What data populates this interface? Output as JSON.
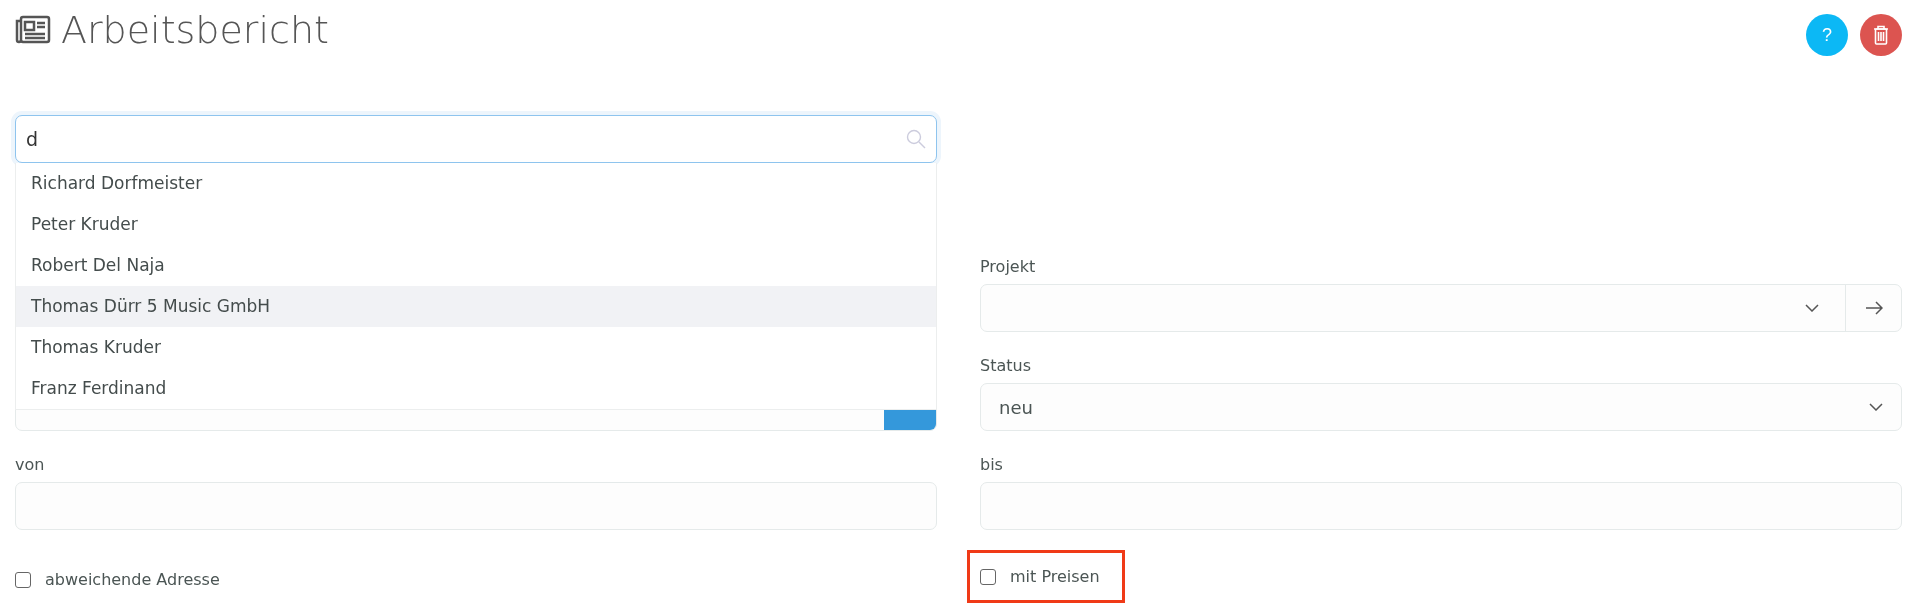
{
  "header": {
    "title": "Arbeitsbericht",
    "actions": [
      {
        "kind": "help",
        "label": "?"
      },
      {
        "kind": "delete"
      }
    ]
  },
  "search": {
    "value": "d",
    "suggestions": [
      {
        "label": "Richard Dorfmeister",
        "selected": false
      },
      {
        "label": "Peter Kruder",
        "selected": false
      },
      {
        "label": "Robert Del Naja",
        "selected": false
      },
      {
        "label": "Thomas Dürr 5 Music GmbH",
        "selected": true
      },
      {
        "label": "Thomas Kruder",
        "selected": false
      },
      {
        "label": "Franz Ferdinand",
        "selected": false
      }
    ]
  },
  "projekt": {
    "label": "Projekt"
  },
  "status": {
    "label": "Status",
    "value": "neu"
  },
  "von": {
    "label": "von"
  },
  "bis": {
    "label": "bis"
  },
  "checkboxes": [
    {
      "label": "abweichende Adresse",
      "checked": false,
      "highlighted": false
    },
    {
      "label": "mit Preisen",
      "checked": false,
      "highlighted": true
    }
  ]
}
